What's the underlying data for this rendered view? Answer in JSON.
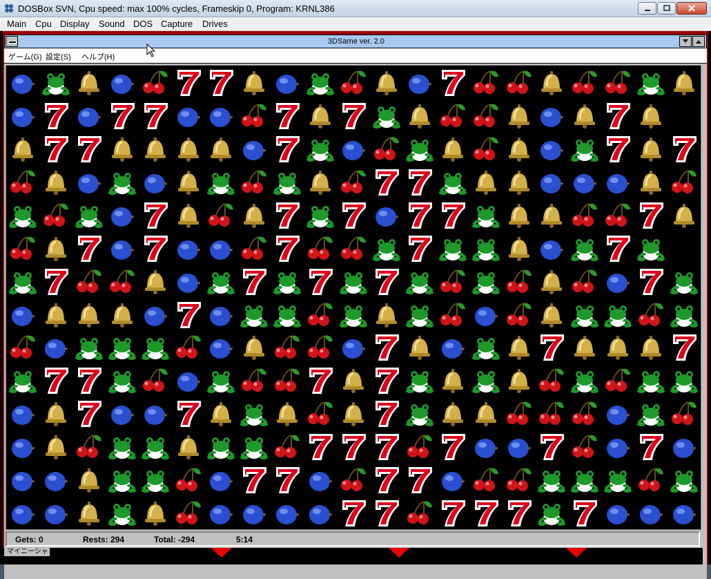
{
  "host": {
    "title": "DOSBox SVN, Cpu speed: max 100% cycles, Frameskip  0, Program:   KRNL386",
    "menu": [
      "Main",
      "Cpu",
      "Display",
      "Sound",
      "DOS",
      "Capture",
      "Drives"
    ]
  },
  "game": {
    "title": "3DSame ver. 2.0",
    "menu": [
      "ゲーム(G)",
      "設定(S)",
      "ヘルプ(H)"
    ],
    "status": {
      "gets": "Gets: 0",
      "rests": "Rests: 294",
      "total": "Total: -294",
      "time": "5:14"
    },
    "task_label": "マイニーシャ",
    "board": {
      "legend": {
        "B": "blueberry",
        "F": "frog",
        "L": "bell",
        "C": "cherry",
        "S": "seven"
      },
      "rows": [
        "BFLBCSSLBFCLBSCCLCCFL",
        "BSBSSBBCSLSFLCCLBLSL",
        "LSSLLLLBSFBCFLCLBFSLS",
        "CLBFBLFCFLCSSFLLBBBLC",
        "FCFBSLCLSFSBSSFLLCCSL",
        "CLSBSBBCSCCFSFFLBFSF",
        "FSCCLBFSFSFSFCFCLCBSF",
        "BLLLBSBFFCFLFCBCLFFCF",
        "CBFFFCBLCCBSLBFLSLLLS",
        "FSSFCBFCCSLSFLFLCFCFF",
        "BLSBBSLFLCLSFLLCCCBFC",
        "BLCFFLFFCSSSCSBBSCBSB",
        "BBLFFCBSSBCSSBCCFFFCF",
        "BBLFLCBBBBSSCSSSFSBBB"
      ]
    }
  },
  "colors": {
    "board_bg": "#000000",
    "inner_title_bg": "#a8c8f0",
    "seven_red": "#e0001a",
    "blueberry": "#2a4fd0",
    "frog_green": "#1d9a2a",
    "bell_gold": "#d4b048",
    "cherry_red": "#d01418"
  }
}
